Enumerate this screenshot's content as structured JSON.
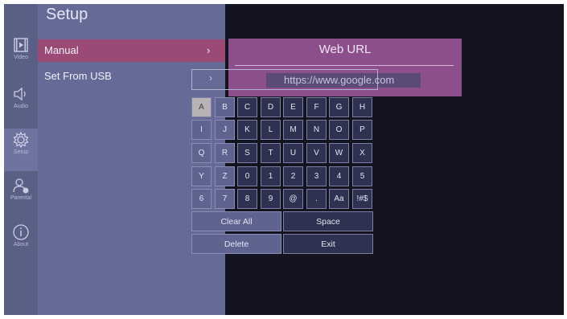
{
  "sidebar": {
    "items": [
      {
        "label": "Video",
        "icon": "video-icon"
      },
      {
        "label": "Audio",
        "icon": "audio-icon"
      },
      {
        "label": "Setup",
        "icon": "gear-icon"
      },
      {
        "label": "Parental",
        "icon": "parental-icon"
      },
      {
        "label": "About",
        "icon": "info-icon"
      }
    ],
    "active_index": 2
  },
  "panel": {
    "title": "Setup",
    "items": [
      {
        "label": "Manual",
        "chevron": "›"
      },
      {
        "label": "Set From USB",
        "chevron": "›"
      }
    ]
  },
  "dialog": {
    "title": "Web URL",
    "url": "https://www.google.com"
  },
  "keyboard": {
    "rows": [
      [
        "A",
        "B",
        "C",
        "D",
        "E",
        "F",
        "G",
        "H"
      ],
      [
        "I",
        "J",
        "K",
        "L",
        "M",
        "N",
        "O",
        "P"
      ],
      [
        "Q",
        "R",
        "S",
        "T",
        "U",
        "V",
        "W",
        "X"
      ],
      [
        "Y",
        "Z",
        "0",
        "1",
        "2",
        "3",
        "4",
        "5"
      ],
      [
        "6",
        "7",
        "8",
        "9",
        "@",
        ".",
        "Aa",
        "!#$"
      ]
    ],
    "focused_key": "A",
    "clear_all": "Clear All",
    "space": "Space",
    "delete": "Delete",
    "exit": "Exit"
  },
  "colors": {
    "selected_menu": "#9a4a74",
    "dialog": "#8c4f8c",
    "background": "#141420"
  }
}
